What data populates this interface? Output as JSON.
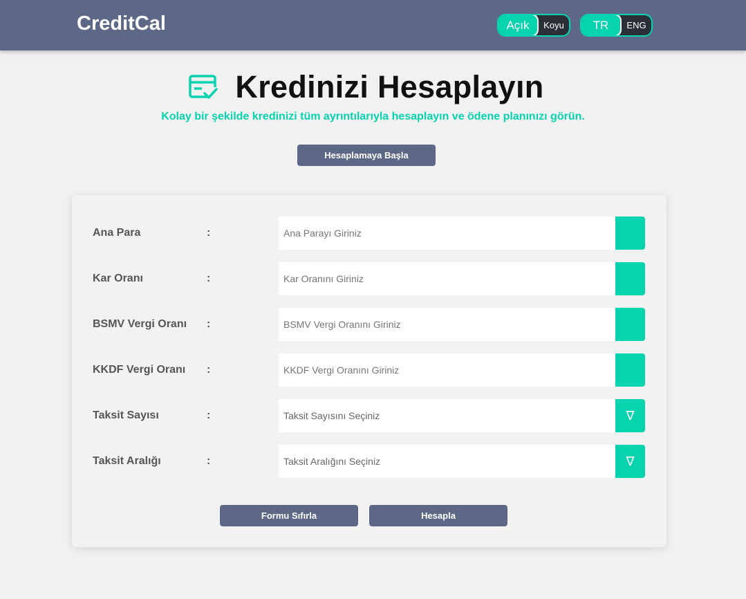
{
  "header": {
    "brand": "CreditCal",
    "theme_toggle": {
      "active": "Açık",
      "inactive": "Koyu"
    },
    "language_toggle": {
      "active": "TR",
      "inactive": "ENG"
    }
  },
  "hero": {
    "icon": "credit-card-check-icon",
    "title": "Kredinizi Hesaplayın",
    "subtitle": "Kolay bir şekilde kredinizi tüm ayrıntılarıyla hesaplayın ve ödene planınızı görün.",
    "start_button": "Hesaplamaya Başla"
  },
  "form": {
    "separator": ":",
    "rows": [
      {
        "label": "Ana Para",
        "placeholder": "Ana Parayı Giriniz",
        "type": "input"
      },
      {
        "label": "Kar Oranı",
        "placeholder": "Kar Oranını Giriniz",
        "type": "input"
      },
      {
        "label": "BSMV Vergi Oranı",
        "placeholder": "BSMV Vergi Oranını Giriniz",
        "type": "input"
      },
      {
        "label": "KKDF Vergi Oranı",
        "placeholder": "KKDF Vergi Oranını Giriniz",
        "type": "input"
      },
      {
        "label": "Taksit Sayısı",
        "placeholder": "Taksit Sayısını Seçiniz",
        "type": "select",
        "addon": "∇"
      },
      {
        "label": "Taksit Aralığı",
        "placeholder": "Taksit Aralığını Seçiniz",
        "type": "select",
        "addon": "∇"
      }
    ],
    "reset_button": "Formu Sıfırla",
    "calculate_button": "Hesapla"
  },
  "colors": {
    "navbar": "#5c6886",
    "accent": "#07d3ae",
    "background": "#f1f1f1"
  }
}
